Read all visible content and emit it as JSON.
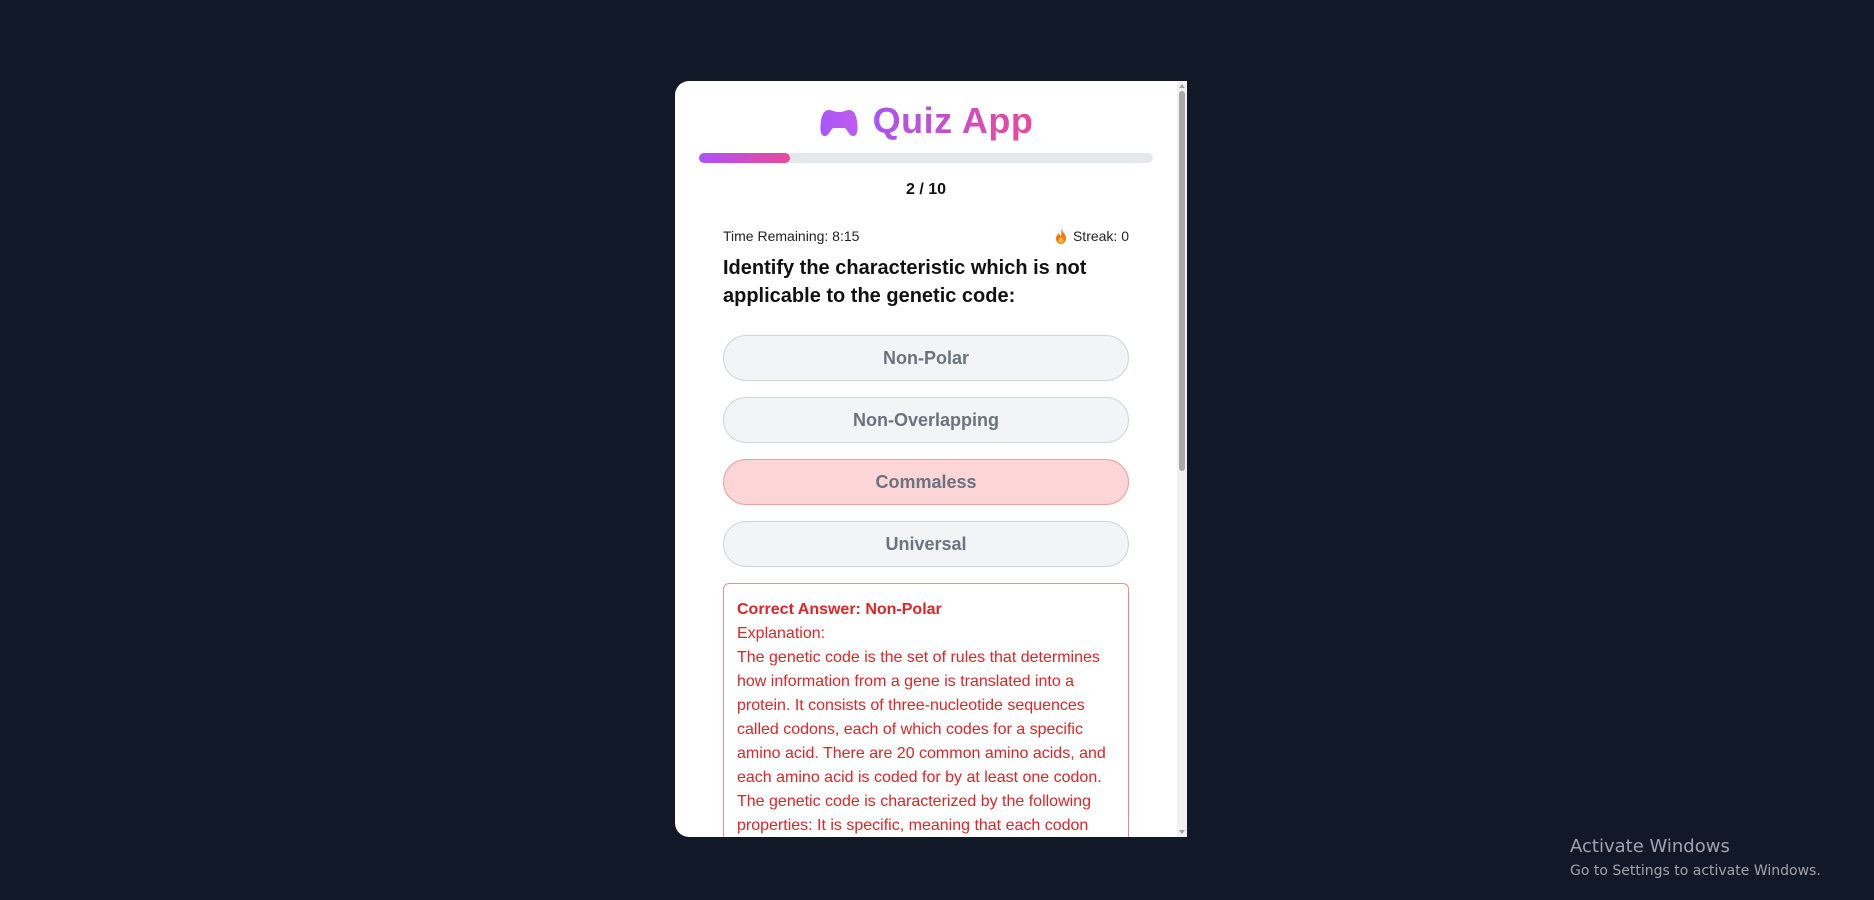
{
  "app": {
    "title": "Quiz App",
    "icon": "gamepad-icon",
    "accent_start": "#a855f7",
    "accent_end": "#ec4899"
  },
  "progress": {
    "fraction": 0.2,
    "counter_text": "2 / 10"
  },
  "status": {
    "time_remaining": "Time Remaining: 8:15",
    "streak": "Streak: 0",
    "streak_icon": "fire-icon"
  },
  "question": {
    "text": "Identify the characteristic which is not applicable to the genetic code:"
  },
  "options": [
    {
      "label": "Non-Polar",
      "state": "default"
    },
    {
      "label": "Non-Overlapping",
      "state": "default"
    },
    {
      "label": "Commaless",
      "state": "wrong"
    },
    {
      "label": "Universal",
      "state": "default"
    }
  ],
  "feedback": {
    "correct_answer": "Correct Answer: Non-Polar",
    "explanation_label": "Explanation:",
    "explanation_text": "The genetic code is the set of rules that determines how information from a gene is translated into a protein. It consists of three-nucleotide sequences called codons, each of which codes for a specific amino acid. There are 20 common amino acids, and each amino acid is coded for by at least one codon. The genetic code is characterized by the following properties: It is specific, meaning that each codon",
    "color": "#dc2626"
  },
  "system": {
    "watermark_title": "Activate Windows",
    "watermark_subtitle": "Go to Settings to activate Windows."
  }
}
